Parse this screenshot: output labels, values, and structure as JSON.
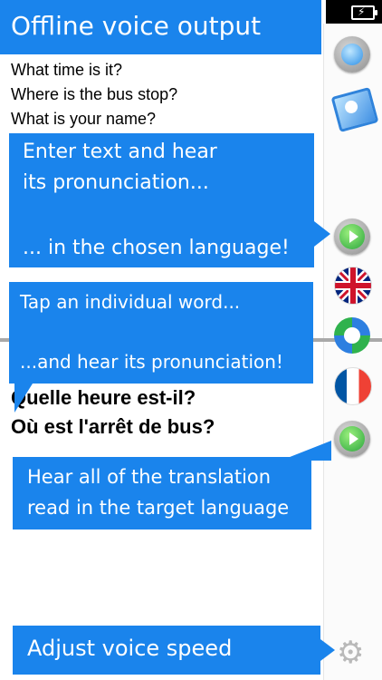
{
  "title": "Offline voice output",
  "source_lines": [
    "What time is it?",
    "Where is the bus stop?",
    "What is your name?"
  ],
  "target_lines": [
    "Quelle heure est-il?",
    "Où est l'arrêt de bus?"
  ],
  "callouts": {
    "enter_text": {
      "line1": "Enter text and hear",
      "line2": "its pronunciation...",
      "line3": "... in the chosen language!"
    },
    "tap_word": {
      "line1": "Tap an individual word...",
      "line2": "...and hear its pronunciation!"
    },
    "hear_all": {
      "line1": "Hear all of the translation",
      "line2": "read in the target language"
    },
    "adjust": {
      "line1": "Adjust voice speed"
    }
  },
  "icons": {
    "record": "record-button-icon",
    "photo": "photo-icon",
    "play_source": "play-icon",
    "uk": "uk-flag-icon",
    "swap": "swap-languages-icon",
    "fr": "france-flag-icon",
    "play_target": "play-icon",
    "settings": "gear-icon"
  },
  "colors": {
    "callout": "#1a84ec",
    "divider": "#a9a9a9"
  }
}
